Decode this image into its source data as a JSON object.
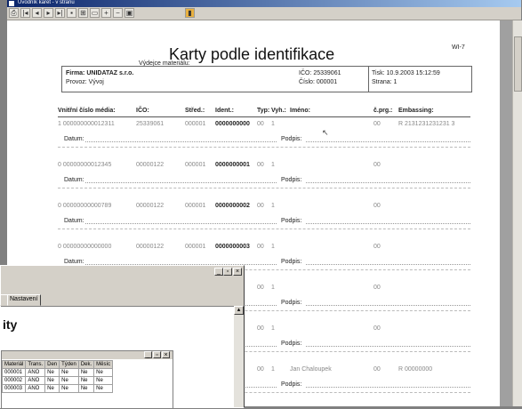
{
  "window": {
    "title": "Úvodník karet - v stranu"
  },
  "toolbar": {
    "icons": [
      "print-icon",
      "first-page-icon",
      "prev-page-icon",
      "next-page-icon",
      "last-page-icon",
      "save-icon",
      "zoom-icon",
      "page-icon",
      "zoom-in-icon",
      "zoom-out-icon",
      "close-icon"
    ]
  },
  "report": {
    "title": "Karty podle identifikace",
    "code": "WI-7",
    "issuer_label": "Výdejce materiálu:",
    "firma": "Firma: UNIDATAZ s.r.o.",
    "provoz": "Provoz: Vývoj",
    "ico": "IČO:  25339061",
    "cislo": "Číslo: 000001",
    "tisk": "Tisk: 10.9.2003 15:12:59",
    "strana": "Strana: 1",
    "headers": {
      "media": "Vnitřní číslo média:",
      "ico": "IČO:",
      "stred": "Střed.:",
      "ident": "Ident.:",
      "typ": "Typ:",
      "vyh": "Vyh.:",
      "jmeno": "Iméno:",
      "cprg": "č.prg.:",
      "emb": "Embassing:"
    },
    "datum_label": "Datum:",
    "podpis_label": "Podpis:",
    "rows": [
      {
        "media": "1  000000000012311",
        "ico": "25339061",
        "stred": "000001",
        "ident": "0000000000",
        "typ": "00",
        "vyh": "1",
        "jmeno": "",
        "cprg": "00",
        "emb": "R  2131231231231 3"
      },
      {
        "media": "0  00000000012345",
        "ico": "00000122",
        "stred": "000001",
        "ident": "0000000001",
        "typ": "00",
        "vyh": "1",
        "jmeno": "",
        "cprg": "00",
        "emb": ""
      },
      {
        "media": "0  00000000000789",
        "ico": "00000122",
        "stred": "000001",
        "ident": "0000000002",
        "typ": "00",
        "vyh": "1",
        "jmeno": "",
        "cprg": "00",
        "emb": ""
      },
      {
        "media": "0  00000000000000",
        "ico": "00000122",
        "stred": "000001",
        "ident": "0000000003",
        "typ": "00",
        "vyh": "1",
        "jmeno": "",
        "cprg": "00",
        "emb": ""
      },
      {
        "media": "",
        "ico": "",
        "stred": "",
        "ident": "",
        "typ": "00",
        "vyh": "1",
        "jmeno": "",
        "cprg": "00",
        "emb": ""
      },
      {
        "media": "",
        "ico": "",
        "stred": "",
        "ident": "",
        "typ": "00",
        "vyh": "1",
        "jmeno": "",
        "cprg": "00",
        "emb": ""
      },
      {
        "media": "",
        "ico": "",
        "stred": "",
        "ident": "",
        "typ": "00",
        "vyh": "1",
        "jmeno": "Jan Chaloupek",
        "cprg": "00",
        "emb": "R  00000000"
      }
    ]
  },
  "overlay": {
    "tab_label": "Nastavení",
    "heading": "ity",
    "grid_headers": [
      "Materiál",
      "Trans.",
      "Den",
      "Týden",
      "Dek.",
      "Měsíc"
    ],
    "grid_rows": [
      [
        "000001",
        "ANO",
        "Ne",
        "Ne",
        "Ne",
        "Ne"
      ],
      [
        "000002",
        "ANO",
        "Ne",
        "Ne",
        "Ne",
        "Ne"
      ],
      [
        "000003",
        "ANO",
        "Ne",
        "Ne",
        "Ne",
        "Ne"
      ]
    ]
  }
}
